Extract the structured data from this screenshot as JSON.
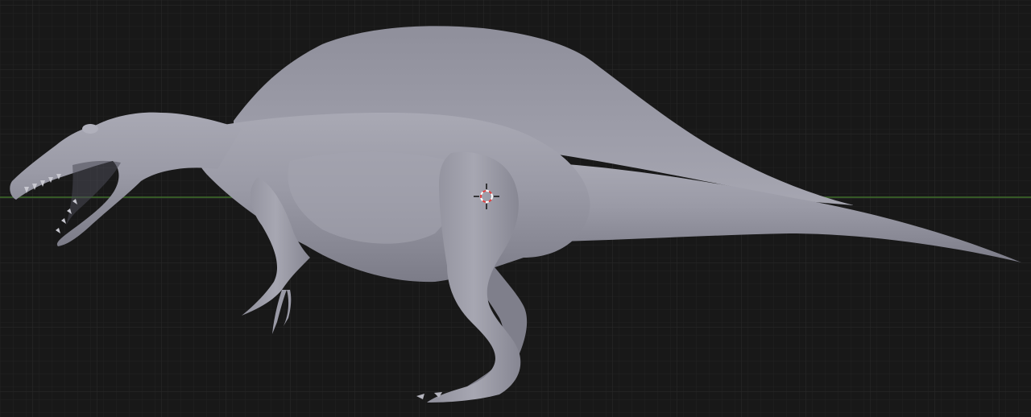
{
  "viewport": {
    "background_color": "#181818",
    "grid_minor_color": "#222222",
    "grid_major_color": "#2c2c2c",
    "x_axis_color": "#3f6f2a",
    "shaded_mode": "solid"
  },
  "model": {
    "object": "spinosaurus-sculpt",
    "base_color": "#9a9aa6",
    "highlight_color": "#c3c3cd",
    "shadow_color": "#6d6d78"
  },
  "cursor_3d": {
    "icon": "3d-cursor-icon",
    "ring_color_a": "#e04040",
    "ring_color_b": "#ffffff"
  }
}
